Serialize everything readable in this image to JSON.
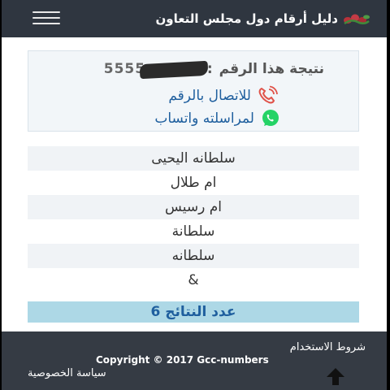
{
  "header": {
    "site_title": "دليل أرقام دول مجلس التعاون",
    "logo_icon": "flowers-logo-icon",
    "menu_icon": "hamburger-menu-icon"
  },
  "result": {
    "label": "نتيجة هذا الرقم",
    "colon": ":",
    "phone_number": "5555xxxxxx",
    "call_label": "للاتصال بالرقم",
    "call_icon": "phone-icon",
    "whatsapp_label": "لمراسلته واتساب",
    "whatsapp_icon": "whatsapp-icon"
  },
  "names": [
    "سلطانه اليحيى",
    "ام طلال",
    "ام رسيس",
    "سلطانة",
    "سلطانه",
    "&"
  ],
  "results_count": "عدد النتائج 6",
  "footer": {
    "terms": "شروط الاستخدام",
    "copyright": "Copyright © 2017 Gcc-numbers",
    "privacy": "سياسة الخصوصية",
    "scroll_icon": "arrow-up-icon"
  },
  "colors": {
    "header_bg": "#2f3640",
    "footer_bg": "#353b44",
    "link": "#1f5f9e",
    "count_bg": "#add8e6",
    "whatsapp": "#25d366",
    "phone": "#e0534a"
  }
}
